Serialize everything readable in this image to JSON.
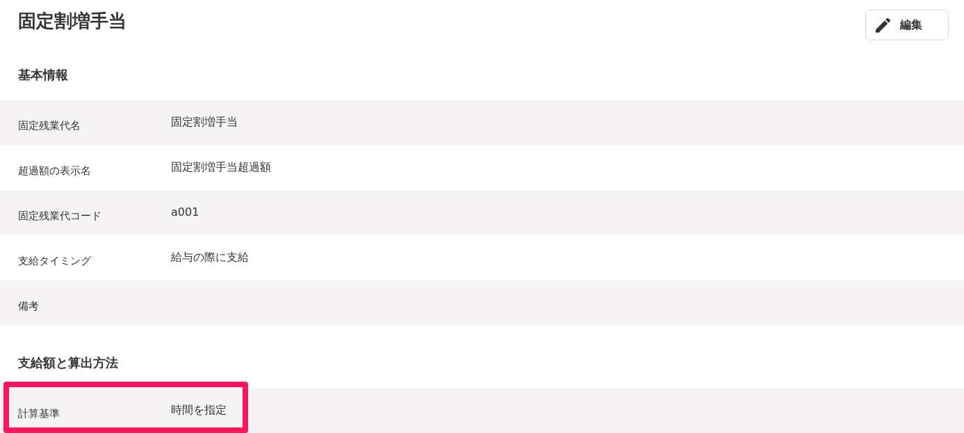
{
  "page": {
    "title": "固定割増手当",
    "edit_button": {
      "label": "編集"
    }
  },
  "sections": [
    {
      "heading": "基本情報",
      "rows": [
        {
          "label": "固定残業代名",
          "value": "固定割増手当",
          "highlighted": false
        },
        {
          "label": "超過額の表示名",
          "value": "固定割増手当超過額",
          "highlighted": false
        },
        {
          "label": "固定残業代コード",
          "value": "a001",
          "highlighted": false
        },
        {
          "label": "支給タイミング",
          "value": "給与の際に支給",
          "highlighted": false
        },
        {
          "label": "備考",
          "highlighted": false
        }
      ]
    },
    {
      "heading": "支給額と算出方法",
      "rows": [
        {
          "label": "計算基準",
          "value": "時間を指定",
          "highlighted": true
        }
      ]
    }
  ]
}
